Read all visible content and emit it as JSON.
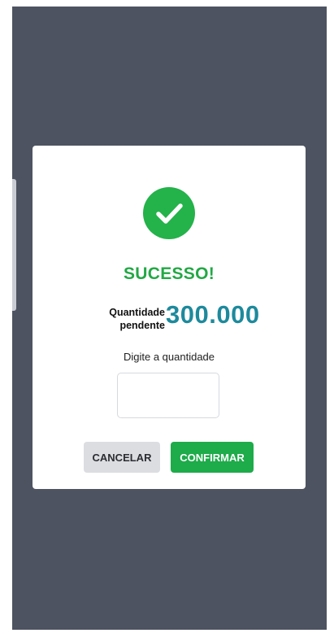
{
  "dialog": {
    "title": "SUCESSO!",
    "quantity_label_line1": "Quantidade",
    "quantity_label_line2": "pendente",
    "quantity_value": "300.000",
    "input_label": "Digite a quantidade",
    "input_value": "",
    "input_placeholder": "",
    "cancel_label": "CANCELAR",
    "confirm_label": "CONFIRMAR",
    "icon": "check-circle-icon"
  },
  "colors": {
    "overlay": "#4d5361",
    "success_green": "#24b24a",
    "quantity_teal": "#1d8a9c",
    "cancel_gray": "#dcdde1"
  }
}
